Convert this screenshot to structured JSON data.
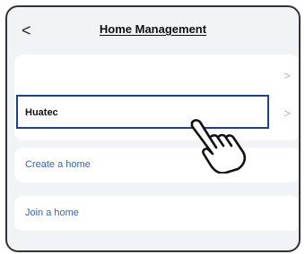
{
  "header": {
    "back_icon": "<",
    "title": "Home Management"
  },
  "homes": [
    {
      "label": "",
      "chevron": ">"
    },
    {
      "label": "Huatec",
      "chevron": ">"
    }
  ],
  "actions": {
    "create": "Create a home",
    "join": "Join a home"
  },
  "icons": {
    "back": "chevron-left-icon",
    "chevron": "chevron-right-icon",
    "pointer": "pointing-hand-icon"
  },
  "colors": {
    "accent_text": "#3a62b4",
    "highlight_border": "#1f3f8a",
    "background": "#f1f3f6"
  }
}
